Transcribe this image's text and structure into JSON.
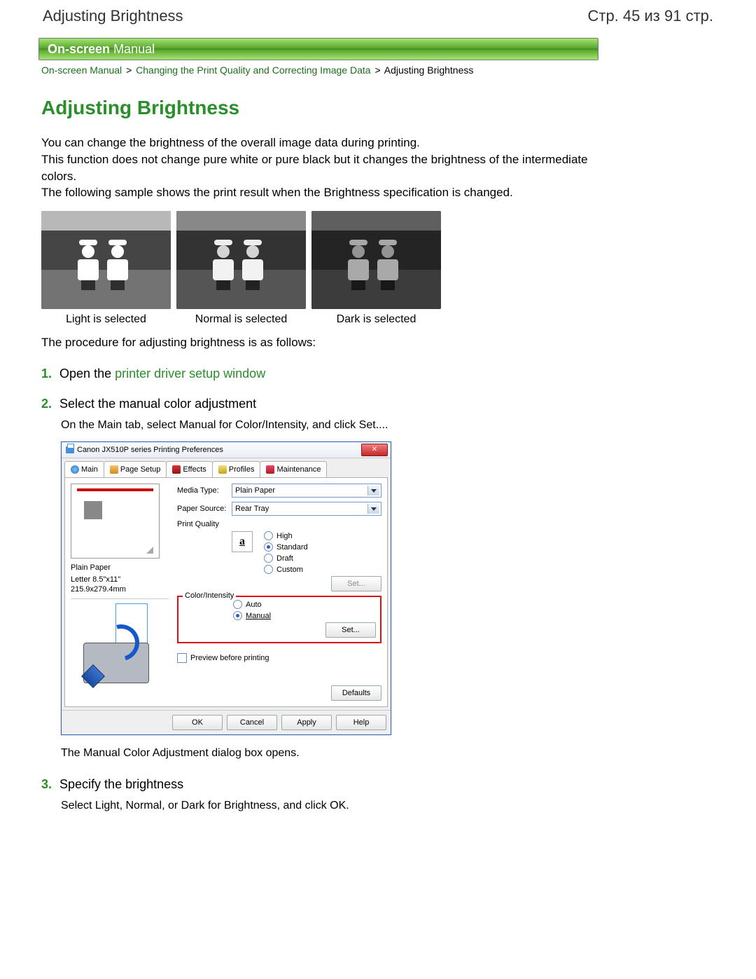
{
  "header": {
    "page_title": "Adjusting Brightness",
    "page_counter": "Стр. 45 из 91 стр."
  },
  "banner": {
    "prefix": "On-screen",
    "suffix": "Manual"
  },
  "breadcrumb": {
    "item1": "On-screen Manual",
    "item2": "Changing the Print Quality and Correcting Image Data",
    "item3": "Adjusting Brightness",
    "sep": ">"
  },
  "main_title": "Adjusting Brightness",
  "intro": {
    "line1": "You can change the brightness of the overall image data during printing.",
    "line2": "This function does not change pure white or pure black but it changes the brightness of the intermediate colors.",
    "line3": "The following sample shows the print result when the Brightness specification is changed."
  },
  "samples": {
    "light": "Light is selected",
    "normal": "Normal is selected",
    "dark": "Dark is selected"
  },
  "procedure_intro": "The procedure for adjusting brightness is as follows:",
  "steps": {
    "s1": {
      "num": "1.",
      "prefix": "Open the ",
      "link": "printer driver setup window"
    },
    "s2": {
      "num": "2.",
      "title": "Select the manual color adjustment",
      "body": "On the Main tab, select Manual for Color/Intensity, and click Set....",
      "after": "The Manual Color Adjustment dialog box opens."
    },
    "s3": {
      "num": "3.",
      "title": "Specify the brightness",
      "body": "Select Light, Normal, or Dark for Brightness, and click OK."
    }
  },
  "dialog": {
    "title": "Canon JX510P series Printing Preferences",
    "close": "✕",
    "tabs": {
      "main": "Main",
      "page_setup": "Page Setup",
      "effects": "Effects",
      "profiles": "Profiles",
      "maintenance": "Maintenance"
    },
    "left": {
      "status1": "Plain Paper",
      "status2": "Letter 8.5\"x11\" 215.9x279.4mm"
    },
    "media_type": {
      "label": "Media Type:",
      "value": "Plain Paper"
    },
    "paper_source": {
      "label": "Paper Source:",
      "value": "Rear Tray"
    },
    "print_quality": {
      "label": "Print Quality",
      "high": "High",
      "standard": "Standard",
      "draft": "Draft",
      "custom": "Custom",
      "set": "Set..."
    },
    "color_intensity": {
      "label": "Color/Intensity",
      "auto": "Auto",
      "manual": "Manual",
      "set": "Set..."
    },
    "preview": "Preview before printing",
    "defaults": "Defaults",
    "footer": {
      "ok": "OK",
      "cancel": "Cancel",
      "apply": "Apply",
      "help": "Help"
    }
  }
}
